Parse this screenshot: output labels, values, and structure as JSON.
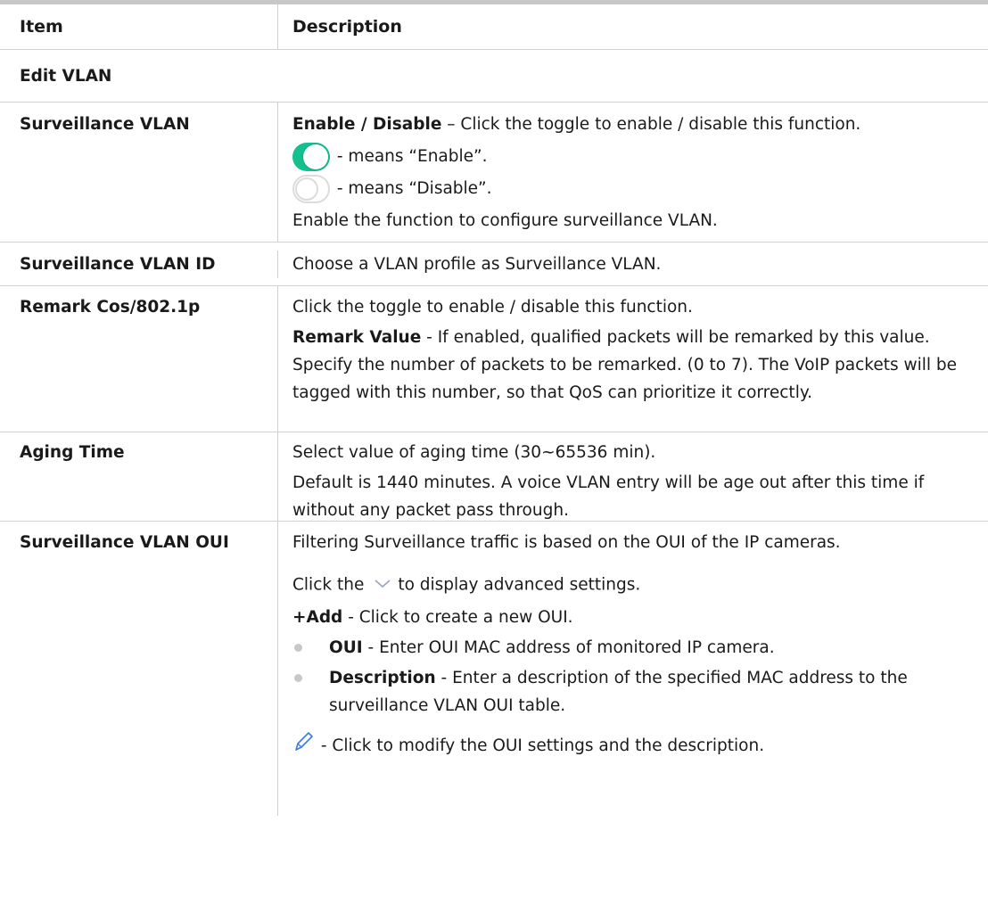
{
  "table": {
    "header": {
      "item": "Item",
      "description": "Description"
    },
    "section": "Edit VLAN",
    "rows": [
      {
        "label": "Surveillance VLAN",
        "enable_bold": "Enable / Disable",
        "enable_text": " – Click the toggle to enable / disable this function.",
        "toggle_on_text": " - means “Enable”.",
        "toggle_off_text": " - means “Disable”.",
        "extra": "Enable the function to configure surveillance VLAN."
      },
      {
        "label": "Surveillance VLAN ID",
        "text": "Choose a VLAN profile as Surveillance VLAN."
      },
      {
        "label": "Remark Cos/802.1p",
        "text1": "Click the toggle to enable / disable this function.",
        "bold": "Remark Value",
        "text2": " - If enabled, qualified packets will be remarked by this value. Specify the number of packets to be remarked. (0 to 7). The VoIP packets will be tagged with this number, so that QoS can prioritize it correctly."
      },
      {
        "label": "Aging Time",
        "text1": "Select value of aging time (30~65536 min).",
        "text2": "Default is 1440 minutes. A voice VLAN entry will be age out after this time if without any packet pass through."
      },
      {
        "label": "Surveillance VLAN OUI",
        "text1": "Filtering Surveillance traffic is based on the OUI of the IP cameras.",
        "click_pre": "Click the",
        "click_post": "to display advanced settings.",
        "add_bold": "+Add",
        "add_text": " - Click to create a new OUI.",
        "bullets": [
          {
            "bold": "OUI",
            "text": " - Enter OUI MAC address of monitored IP camera."
          },
          {
            "bold": "Description",
            "text": " - Enter a description of the specified MAC address to the surveillance VLAN OUI table."
          }
        ],
        "edit_text": " - Click to modify the OUI settings and the description."
      }
    ]
  },
  "colors": {
    "toggle_on": "#14c08d",
    "toggle_off_border": "#dcdcdc",
    "grid": "#d0d0d0"
  },
  "icons": [
    "toggle-on-icon",
    "toggle-off-icon",
    "chevron-down-icon",
    "pencil-icon",
    "bullet-icon"
  ]
}
